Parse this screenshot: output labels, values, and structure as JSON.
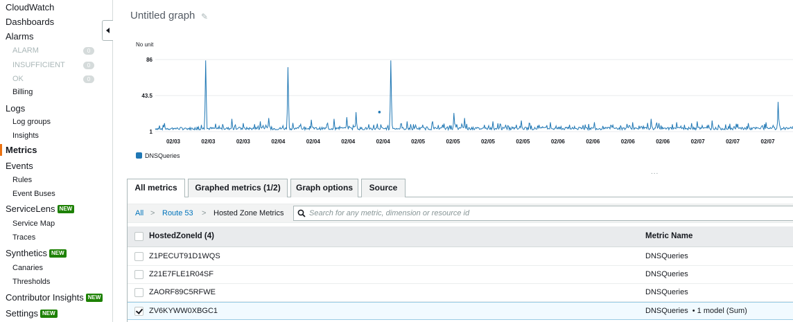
{
  "sidebar": {
    "cloudwatch": "CloudWatch",
    "dashboards": "Dashboards",
    "alarms": "Alarms",
    "alarm_states": [
      {
        "label": "ALARM",
        "count": "0"
      },
      {
        "label": "INSUFFICIENT",
        "count": "0"
      },
      {
        "label": "OK",
        "count": "0"
      }
    ],
    "billing": "Billing",
    "logs": "Logs",
    "log_groups": "Log groups",
    "insights": "Insights",
    "metrics": "Metrics",
    "events": "Events",
    "rules": "Rules",
    "event_buses": "Event Buses",
    "servicelens": "ServiceLens",
    "service_map": "Service Map",
    "traces": "Traces",
    "synthetics": "Synthetics",
    "canaries": "Canaries",
    "thresholds": "Thresholds",
    "contributor_insights": "Contributor Insights",
    "settings": "Settings",
    "new_badge": "NEW"
  },
  "graph": {
    "title": "Untitled graph"
  },
  "chart_data": {
    "type": "line",
    "ylabel": "No unit",
    "yticks": [
      "1",
      "43.5",
      "86"
    ],
    "ylim": [
      1,
      86
    ],
    "xticks": [
      "02/03",
      "02/03",
      "02/03",
      "02/04",
      "02/04",
      "02/04",
      "02/04",
      "02/05",
      "02/05",
      "02/05",
      "02/05",
      "02/06",
      "02/06",
      "02/06",
      "02/06",
      "02/07",
      "02/07",
      "02/07"
    ],
    "series": [
      {
        "name": "DNSQueries",
        "color": "#1f77b4",
        "baseline": 3,
        "spikes": [
          {
            "x": 0.03,
            "y": 11
          },
          {
            "x": 0.095,
            "y": 5
          },
          {
            "x": 0.158,
            "y": 85
          },
          {
            "x": 0.24,
            "y": 16
          },
          {
            "x": 0.275,
            "y": 11
          },
          {
            "x": 0.33,
            "y": 13
          },
          {
            "x": 0.355,
            "y": 17
          },
          {
            "x": 0.4,
            "y": 8
          },
          {
            "x": 0.415,
            "y": 77
          },
          {
            "x": 0.49,
            "y": 15
          },
          {
            "x": 0.54,
            "y": 11
          },
          {
            "x": 0.56,
            "y": 16
          },
          {
            "x": 0.6,
            "y": 18
          },
          {
            "x": 0.63,
            "y": 24
          },
          {
            "x": 0.685,
            "y": 9
          },
          {
            "x": 0.738,
            "y": 85
          },
          {
            "x": 0.79,
            "y": 13
          },
          {
            "x": 0.838,
            "y": 9
          },
          {
            "x": 0.87,
            "y": 13
          },
          {
            "x": 0.902,
            "y": 9
          },
          {
            "x": 0.936,
            "y": 23
          },
          {
            "x": 0.97,
            "y": 17
          },
          {
            "x": 1.06,
            "y": 13
          },
          {
            "x": 1.1,
            "y": 9
          },
          {
            "x": 1.148,
            "y": 14
          },
          {
            "x": 1.18,
            "y": 8
          },
          {
            "x": 1.24,
            "y": 12
          },
          {
            "x": 1.3,
            "y": 9
          },
          {
            "x": 1.376,
            "y": 12
          },
          {
            "x": 1.43,
            "y": 8
          },
          {
            "x": 1.498,
            "y": 12
          },
          {
            "x": 1.556,
            "y": 16
          },
          {
            "x": 1.636,
            "y": 12
          },
          {
            "x": 1.66,
            "y": 9
          },
          {
            "x": 1.7,
            "y": 13
          },
          {
            "x": 1.746,
            "y": 14
          },
          {
            "x": 1.826,
            "y": 10
          },
          {
            "x": 1.86,
            "y": 11
          },
          {
            "x": 1.905,
            "y": 8
          },
          {
            "x": 1.954,
            "y": 36
          }
        ],
        "isolated_point": {
          "x": 0.703,
          "y": 24
        }
      }
    ],
    "legend": [
      "DNSQueries"
    ]
  },
  "tabs": [
    "All metrics",
    "Graphed metrics (1/2)",
    "Graph options",
    "Source"
  ],
  "breadcrumb": {
    "all": "All",
    "sep": ">",
    "route53": "Route 53",
    "current": "Hosted Zone Metrics"
  },
  "search": {
    "placeholder": "Search for any metric, dimension or resource id"
  },
  "table": {
    "headers": [
      "HostedZoneId (4)",
      "Metric Name"
    ],
    "rows": [
      {
        "zone": "Z1PECUT91D1WQS",
        "metric": "DNSQueries",
        "extra": "",
        "checked": false
      },
      {
        "zone": "Z21E7FLE1R04SF",
        "metric": "DNSQueries",
        "extra": "",
        "checked": false
      },
      {
        "zone": "ZAORF89C5RFWE",
        "metric": "DNSQueries",
        "extra": "",
        "checked": false
      },
      {
        "zone": "ZV6KYWW0XBGC1",
        "metric": "DNSQueries",
        "extra": "• 1 model (Sum)",
        "checked": true
      }
    ]
  },
  "more_dots": "..."
}
